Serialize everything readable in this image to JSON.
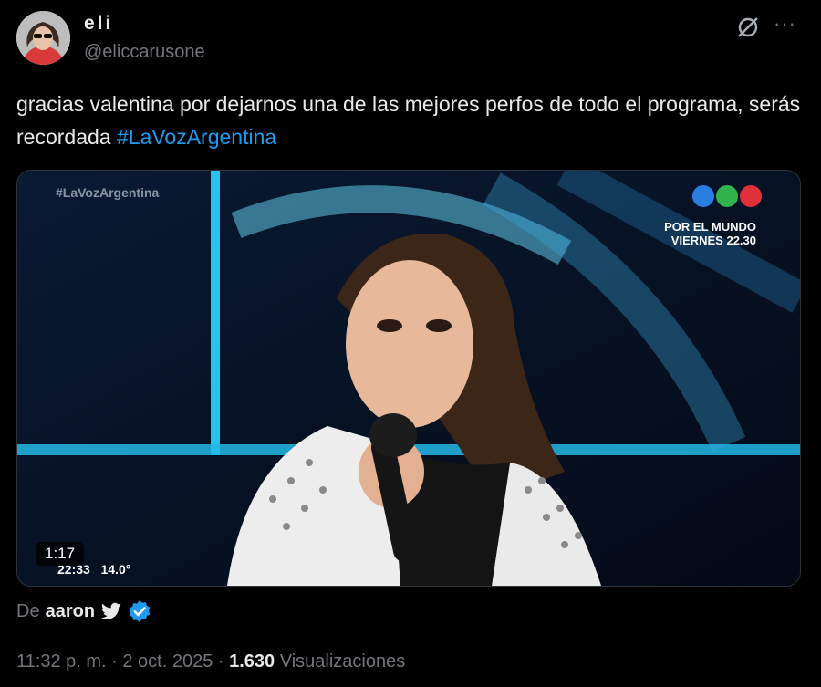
{
  "author": {
    "display_name": "eli",
    "handle": "@eliccarusone"
  },
  "header": {
    "grok_icon": "grok-icon",
    "more_icon": "more-icon",
    "more_label": "···"
  },
  "tweet": {
    "text": "gracias valentina por dejarnos una de las mejores perfos de todo el programa, serás recordada ",
    "hashtag": "#LaVozArgentina"
  },
  "media": {
    "watermark": "#LaVozArgentina",
    "promo_line1": "POR EL MUNDO",
    "promo_line2": "VIERNES 22.30",
    "duration": "1:17",
    "clock_time": "22:33",
    "temperature": "14.0°",
    "logo_colors": [
      "#2a7de1",
      "#2fb34a",
      "#e0303a"
    ]
  },
  "attribution": {
    "prefix": "De",
    "user": "aaron",
    "icons": [
      "twitter-bird-icon",
      "verified-badge-icon"
    ],
    "badge_color": "#1d9bf0"
  },
  "meta": {
    "time": "11:32 p. m.",
    "sep1": " · ",
    "date": "2 oct. 2025",
    "sep2": " · ",
    "views_count": "1.630",
    "views_label": " Visualizaciones"
  }
}
